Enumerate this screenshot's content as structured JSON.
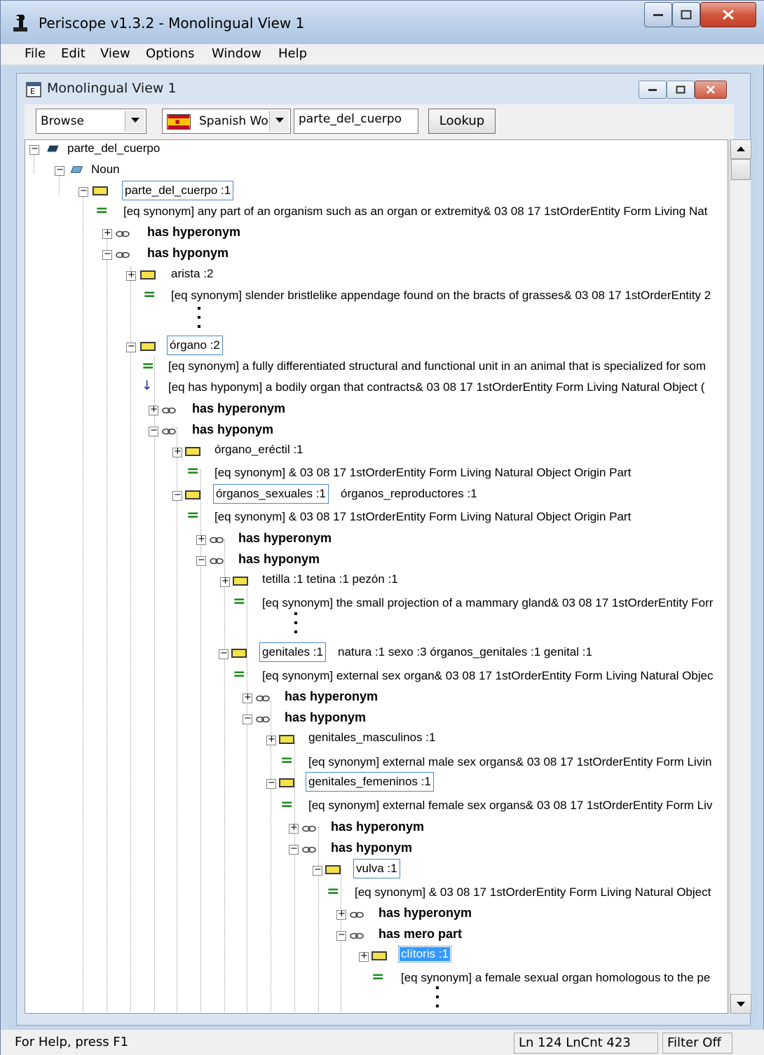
{
  "window": {
    "title": "Periscope v1.3.2 - Monolingual View 1",
    "menu": [
      "File",
      "Edit",
      "View",
      "Options",
      "Window",
      "Help"
    ]
  },
  "child": {
    "title": "Monolingual View 1"
  },
  "toolbar": {
    "mode_value": "Browse",
    "language_value": "Spanish Wo",
    "word_value": "parte_del_cuerpo",
    "lookup_label": "Lookup"
  },
  "tree": {
    "root": "parte_del_cuerpo",
    "pos": "Noun",
    "n1": "parte_del_cuerpo :1",
    "n1_def": "[eq synonym]  any part of an organism such as an organ or extremity& 03 08 17 1stOrderEntity Form Living Nat",
    "has_hyperonym": "has hyperonym",
    "has_hyponym": "has hyponym",
    "has_mero_part": "has mero part",
    "arista": "arista :2",
    "arista_def": "[eq synonym]  slender bristlelike appendage found on the bracts of grasses& 03 08 17 1stOrderEntity 2",
    "organo": "órgano :2",
    "organo_def": "[eq synonym]  a fully differentiated structural and functional unit in an animal that is specialized for som",
    "organo_hyp": "[eq has hyponym]  a bodily organ that contracts& 03 08 17 1stOrderEntity Form Living Natural Object (",
    "eractil": "órgano_eréctil :1",
    "eractil_def": "[eq synonym]  & 03 08 17 1stOrderEntity Form Living Natural Object Origin Part",
    "sexuales": "órganos_sexuales :1",
    "reproductores": "órganos_reproductores :1",
    "sexuales_def": "[eq synonym]  & 03 08 17 1stOrderEntity Form Living Natural Object Origin Part",
    "tetilla": "tetilla :1   tetina :1   pezón :1",
    "tetilla_def": "[eq synonym]  the small projection of a mammary gland& 03 08 17 1stOrderEntity Forr",
    "genitales": "genitales :1",
    "genitales_syn": "natura :1    sexo :3    órganos_genitales :1    genital :1",
    "genitales_def": "[eq synonym]  external sex organ& 03 08 17 1stOrderEntity Form Living Natural Objec",
    "masculinos": "genitales_masculinos :1",
    "masculinos_def": "[eq synonym]  external male sex organs& 03 08 17 1stOrderEntity Form Livin",
    "femeninos": "genitales_femeninos :1",
    "femeninos_def": "[eq synonym]  external female sex organs& 03 08 17 1stOrderEntity Form Liv",
    "vulva": "vulva :1",
    "vulva_def": "[eq synonym]  & 03 08 17 1stOrderEntity Form Living Natural Object",
    "clitoris": "clítoris :1",
    "clitoris_def": "[eq synonym]  a female sexual organ homologous to the pe"
  },
  "status": {
    "help": "For Help, press F1",
    "line": "Ln 124 LnCnt 423",
    "filter": "Filter Off"
  },
  "colors": {
    "selection": "#3399ff",
    "synonym_marker": "#1d8c1d",
    "synset_icon": "#f4e24a"
  }
}
